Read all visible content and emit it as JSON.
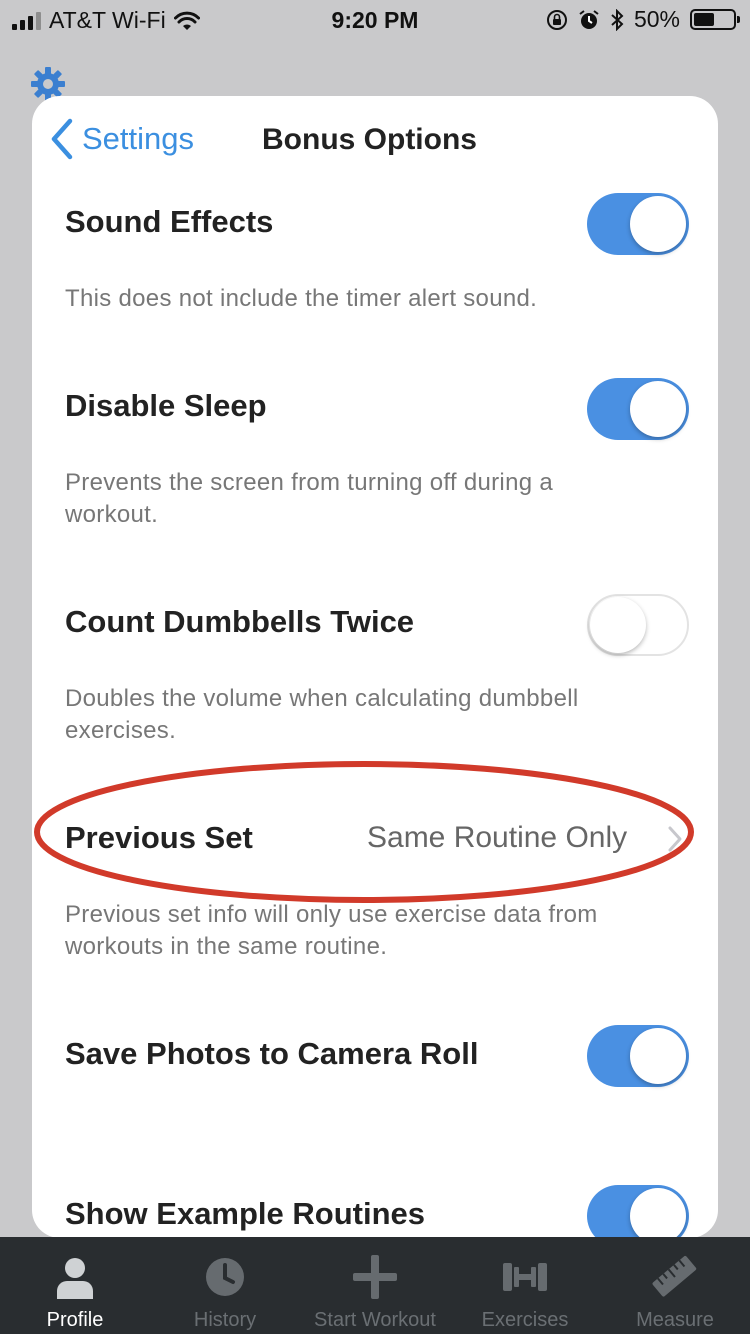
{
  "status_bar": {
    "carrier": "AT&T Wi-Fi",
    "time": "9:20 PM",
    "battery_percent": "50%",
    "battery_level": 0.5,
    "signal_bars": 3
  },
  "nav": {
    "back_label": "Settings",
    "title": "Bonus Options"
  },
  "settings": {
    "sound_effects": {
      "title": "Sound Effects",
      "description": "This does not include the timer alert sound.",
      "enabled": true
    },
    "disable_sleep": {
      "title": "Disable Sleep",
      "description": "Prevents the screen from turning off during a workout.",
      "enabled": true
    },
    "count_dumbbells": {
      "title": "Count Dumbbells Twice",
      "description": "Doubles the volume when calculating dumbbell exercises.",
      "enabled": false
    },
    "previous_set": {
      "title": "Previous Set",
      "value": "Same Routine Only",
      "description": "Previous set info will only use exercise data from workouts in the same routine."
    },
    "save_photos": {
      "title": "Save Photos to Camera Roll",
      "enabled": true
    },
    "example_routines": {
      "title": "Show Example Routines",
      "enabled": true
    }
  },
  "tab_bar": {
    "tabs": [
      {
        "label": "Profile",
        "icon": "person-icon",
        "active": true
      },
      {
        "label": "History",
        "icon": "clock-icon",
        "active": false
      },
      {
        "label": "Start Workout",
        "icon": "plus-icon",
        "active": false
      },
      {
        "label": "Exercises",
        "icon": "dumbbell-icon",
        "active": false
      },
      {
        "label": "Measure",
        "icon": "ruler-icon",
        "active": false
      }
    ]
  },
  "colors": {
    "accent": "#4a90e2",
    "annotation": "#d13a2a",
    "tabbar_bg": "#292d30"
  }
}
